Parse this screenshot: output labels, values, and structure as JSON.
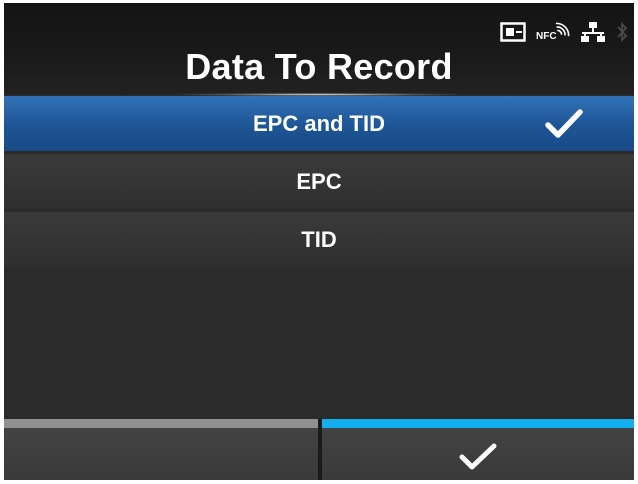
{
  "header": {
    "title": "Data To Record",
    "status_icons": [
      "sd-card-icon",
      "nfc-icon",
      "network-icon",
      "bluetooth-icon"
    ],
    "nfc_label": "NFC"
  },
  "list": {
    "items": [
      {
        "label": "EPC and TID",
        "selected": true
      },
      {
        "label": "EPC",
        "selected": false
      },
      {
        "label": "TID",
        "selected": false
      }
    ]
  },
  "footer": {
    "left_button_icon": "",
    "right_button_icon": "check-icon"
  },
  "colors": {
    "selected_bg": "#1e5595",
    "accent_blue": "#13aef0",
    "inactive_bar": "#909090",
    "background": "#2b2b2b"
  }
}
